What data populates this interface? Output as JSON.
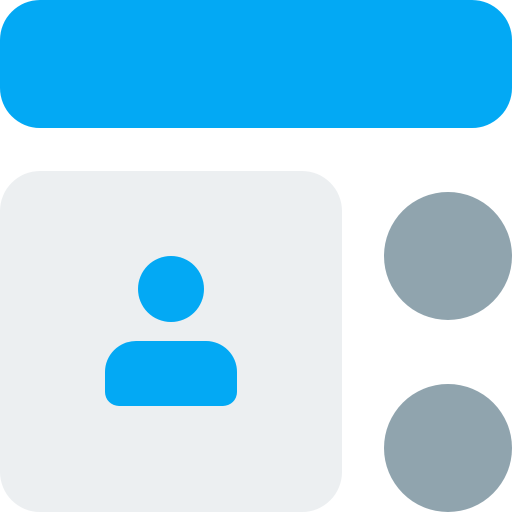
{
  "colors": {
    "accent": "#03A9F4",
    "card": "#ECEFF1",
    "dots": "#90A4AE",
    "background": "#FFFFFF"
  },
  "icons": {
    "avatar": "user-icon",
    "dots": [
      "dot-icon",
      "dot-icon"
    ]
  }
}
